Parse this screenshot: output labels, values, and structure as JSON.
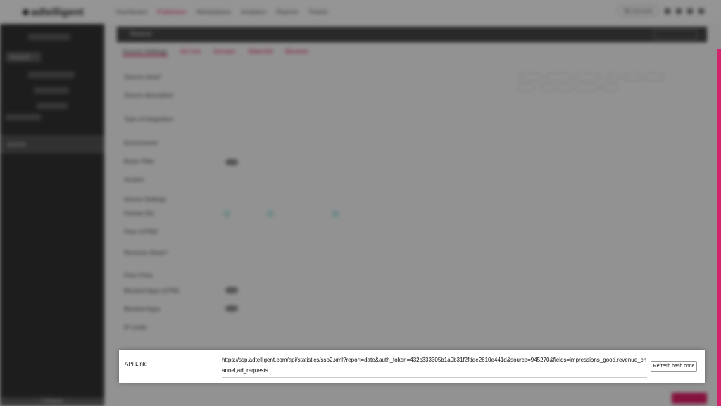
{
  "app": {
    "logo": "adtelligent"
  },
  "top_nav": [
    "Dashboard",
    "Publishers",
    "Marketplace",
    "Analytics",
    "Reports",
    "Tickets"
  ],
  "top_right": {
    "user": "My account"
  },
  "sidebar": {
    "search": "Search",
    "selected": "source",
    "footer": "Collapse"
  },
  "header": {
    "title": "Source",
    "action": "Save"
  },
  "tabs": [
    "Source Settings",
    "Ad Unit",
    "Domain",
    "Waterfall",
    "Blocked"
  ],
  "form_rows": [
    "Source name*",
    "Source description",
    "Type of integration",
    "Environment",
    "Buyer Filter",
    "Auction",
    "Source Settings",
    "Partner IDs",
    "Floor (CPM)*",
    "Revenue Share*",
    "Floor Price",
    "Blocked Apps (CPM)",
    "Blocked Apps",
    "IP Limits"
  ],
  "modal": {
    "api_label": "API Link:",
    "api_url": "https://ssp.adtelligent.com/api/statistics/ssp2.xml?report=date&auth_token=432c333305b1a0b31f2fdde2610e441d&source=945270&fields=impressions_good,revenue_channel,ad_requests",
    "refresh_label": "Refresh hash code"
  },
  "colors": {
    "accent": "#e0115f",
    "sidebar": "#262626"
  }
}
